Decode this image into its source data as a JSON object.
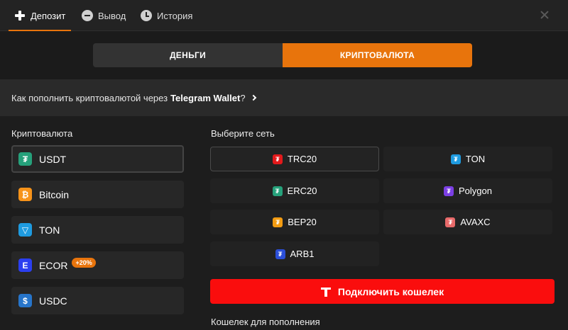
{
  "top_tabs": {
    "deposit": "Депозит",
    "withdraw": "Вывод",
    "history": "История"
  },
  "mode": {
    "money": "ДЕНЬГИ",
    "crypto": "КРИПТОВАЛЮТА",
    "selected": "crypto"
  },
  "info": {
    "prefix": "Как пополнить криптовалютой через",
    "brand": "Telegram Wallet",
    "suffix": "?"
  },
  "currency_section": {
    "label": "Криптовалюта",
    "items": [
      {
        "name": "USDT",
        "icon": "tether-icon",
        "glyph": "₮",
        "color": "#26a17b",
        "selected": true
      },
      {
        "name": "Bitcoin",
        "icon": "bitcoin-icon",
        "glyph": "₿",
        "color": "#f7931a"
      },
      {
        "name": "TON",
        "icon": "ton-icon",
        "glyph": "▽",
        "color": "#1e9be0"
      },
      {
        "name": "ECOR",
        "icon": "ecor-icon",
        "glyph": "E",
        "color": "#2b3ff0",
        "badge": "+20%"
      },
      {
        "name": "USDC",
        "icon": "usdc-icon",
        "glyph": "$",
        "color": "#2775ca"
      }
    ]
  },
  "network_section": {
    "label": "Выберите сеть",
    "items": [
      {
        "name": "TRC20",
        "icon": "trc20-icon",
        "glyph": "₮",
        "color": "#e3191b",
        "selected": true
      },
      {
        "name": "TON",
        "icon": "ton-network-icon",
        "glyph": "₮",
        "color": "#1e9be0"
      },
      {
        "name": "ERC20",
        "icon": "erc20-icon",
        "glyph": "₮",
        "color": "#26a17b"
      },
      {
        "name": "Polygon",
        "icon": "polygon-icon",
        "glyph": "₮",
        "color": "#7b3fe4"
      },
      {
        "name": "BEP20",
        "icon": "bep20-icon",
        "glyph": "₮",
        "color": "#f39c12"
      },
      {
        "name": "AVAXC",
        "icon": "avaxc-icon",
        "glyph": "₮",
        "color": "#e86a6a"
      },
      {
        "name": "ARB1",
        "icon": "arb1-icon",
        "glyph": "₮",
        "color": "#2b4fd8"
      }
    ]
  },
  "connect_button": "Подключить кошелек",
  "wallet_label": "Кошелек для пополнения",
  "colors": {
    "accent": "#e8740c",
    "connect": "#fa0d0d"
  }
}
